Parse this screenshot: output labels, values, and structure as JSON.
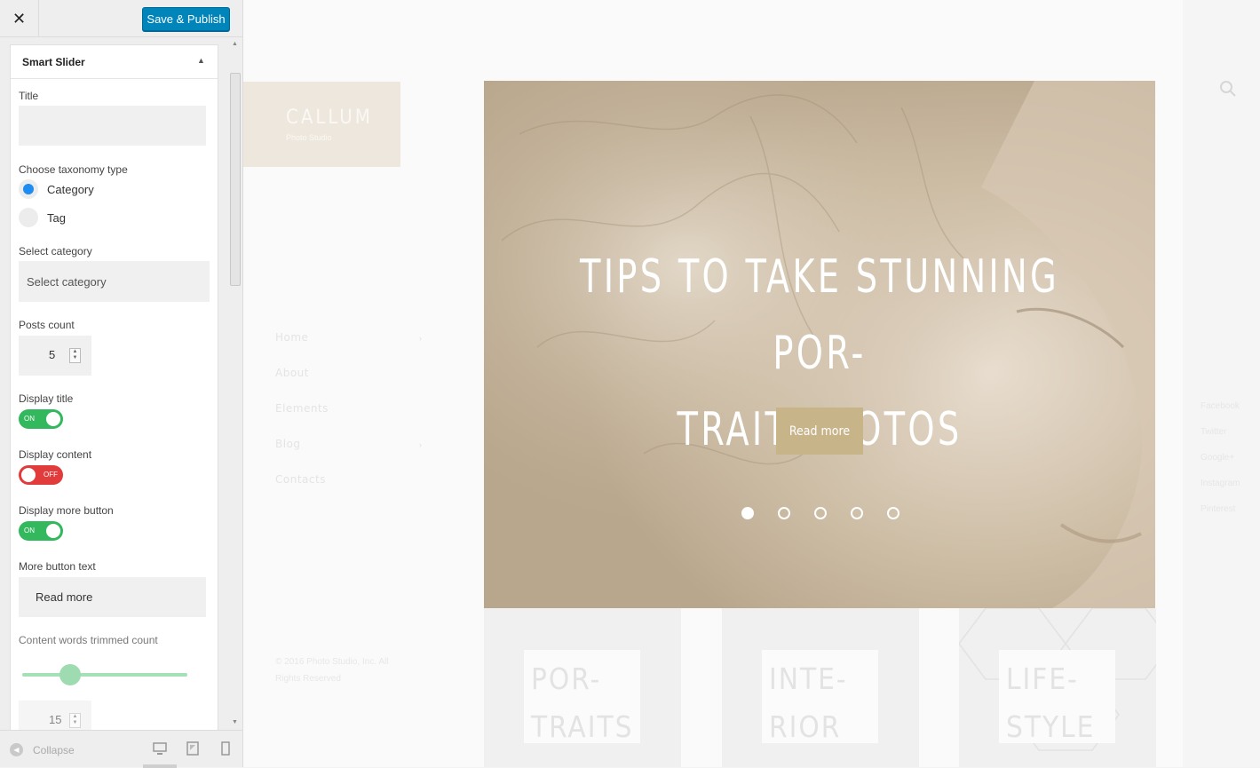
{
  "toolbar": {
    "close_icon": "close-icon",
    "publish_label": "Save & Publish"
  },
  "section": {
    "title": "Smart Slider",
    "collapse_icon": "triangle-up-icon"
  },
  "fields": {
    "title_label": "Title",
    "title_value": "",
    "taxonomy_label": "Choose taxonomy type",
    "taxonomy_options": [
      "Category",
      "Tag"
    ],
    "taxonomy_selected": "Category",
    "category_label": "Select category",
    "category_placeholder": "Select category",
    "posts_count_label": "Posts count",
    "posts_count_value": "5",
    "display_title_label": "Display title",
    "display_title_state": "ON",
    "display_content_label": "Display content",
    "display_content_state": "OFF",
    "display_more_label": "Display more button",
    "display_more_state": "ON",
    "more_text_label": "More button text",
    "more_text_value": "Read more",
    "trim_label": "Content words trimmed count",
    "trim_slider_fraction": 0.29,
    "trim_value": "15"
  },
  "footer": {
    "collapse_label": "Collapse",
    "devices": [
      "desktop-icon",
      "tablet-icon",
      "mobile-icon"
    ]
  },
  "colors": {
    "publish": "#0085ba",
    "toggle_on": "#33b85d",
    "toggle_off": "#e23b3b",
    "radio": "#1e8cf0",
    "accent": "#c8b489"
  },
  "site": {
    "logo_name": "CALLUM",
    "logo_sub": "Photo Studio",
    "nav": [
      "Home",
      "About",
      "Elements",
      "Blog",
      "Contacts"
    ],
    "copyright": "© 2016 Photo Studio, Inc. All Rights Reserved",
    "social": [
      "Facebook",
      "Twitter",
      "Google+",
      "Instagram",
      "Pinterest"
    ],
    "hero_title_line1": "TIPS TO TAKE STUNNING POR-",
    "hero_title_line2": "TRAIT PHOTOS",
    "hero_button": "Read more",
    "slides_count": 5,
    "active_slide": 1,
    "cards": [
      "POR-\nTRAITS",
      "INTE-\nRIOR",
      "LIFE-\nSTYLE"
    ]
  }
}
